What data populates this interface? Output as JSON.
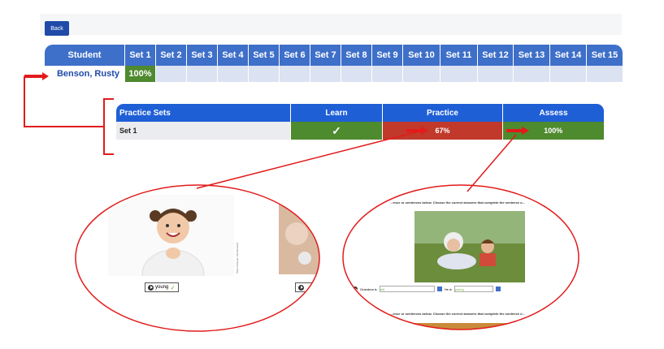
{
  "toolbar": {
    "back_label": "Back"
  },
  "student_grid": {
    "header_student": "Student",
    "sets": [
      "Set 1",
      "Set 2",
      "Set 3",
      "Set 4",
      "Set 5",
      "Set 6",
      "Set 7",
      "Set 8",
      "Set 9",
      "Set 10",
      "Set 11",
      "Set 12",
      "Set 13",
      "Set 14",
      "Set 15"
    ],
    "rows": [
      {
        "name": "Benson, Rusty",
        "scores": [
          "100%",
          "",
          "",
          "",
          "",
          "",
          "",
          "",
          "",
          "",
          "",
          "",
          "",
          "",
          ""
        ]
      }
    ]
  },
  "practice_sets": {
    "headers": {
      "sets": "Practice Sets",
      "learn": "Learn",
      "practice": "Practice",
      "assess": "Assess"
    },
    "rows": [
      {
        "name": "Set 1",
        "learn": "✓",
        "practice": "67%",
        "assess": "100%"
      }
    ]
  },
  "practice_preview": {
    "answer_chip": "young",
    "photo_credit": "©Kat Yahnyuk / Shutterstock"
  },
  "assess_preview": {
    "instruction": "...ence or sentences below. Choose the correct answers that complete the sentence o...",
    "sentence_start": "Grandma is",
    "selected_1": "old",
    "middle": "He is",
    "selected_2": "young",
    "instruction_2": "...ence or sentences below. Choose the correct answers that complete the sentence o..."
  },
  "colors": {
    "header_blue": "#3e6fc9",
    "pass_green": "#4e8a2e",
    "fail_red": "#c0392b",
    "arrow_red": "#e21b1b"
  }
}
